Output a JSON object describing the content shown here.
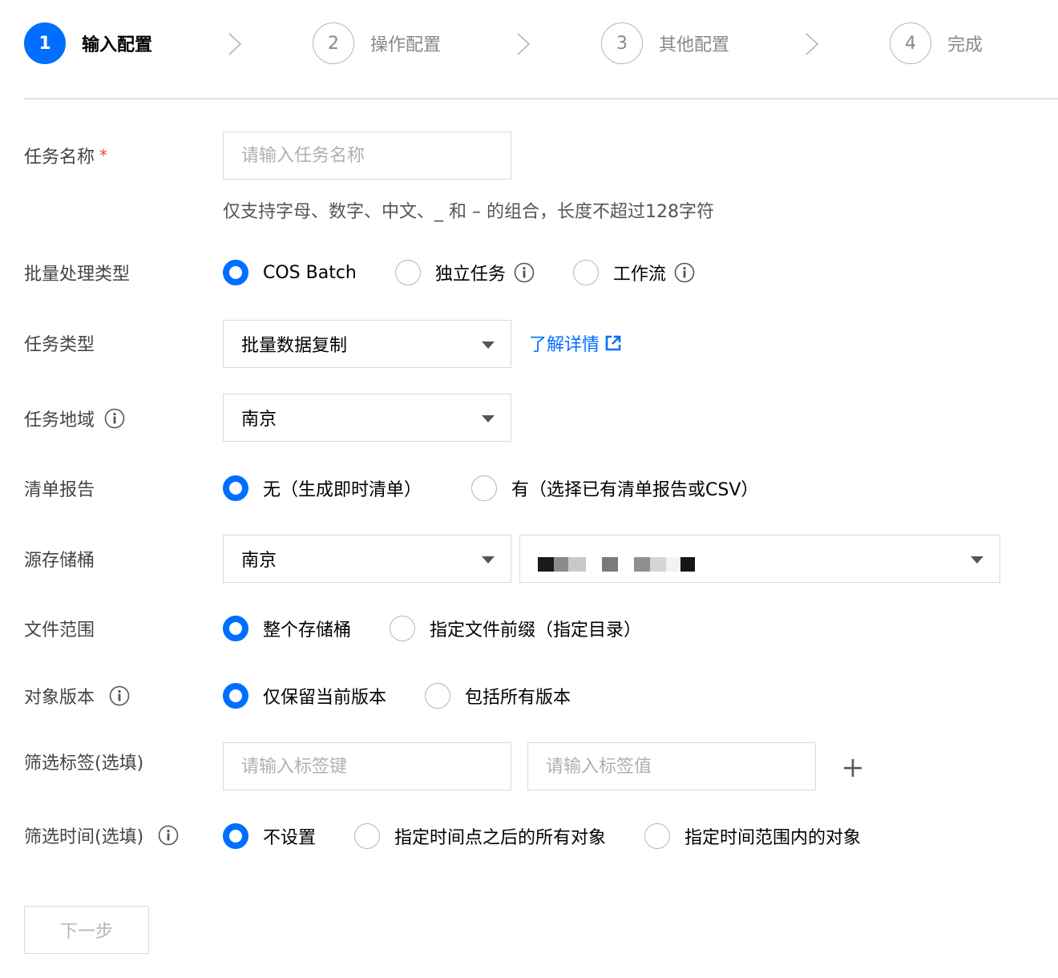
{
  "steps": [
    {
      "number": "1",
      "label": "输入配置",
      "active": true
    },
    {
      "number": "2",
      "label": "操作配置",
      "active": false
    },
    {
      "number": "3",
      "label": "其他配置",
      "active": false
    },
    {
      "number": "4",
      "label": "完成",
      "active": false
    }
  ],
  "form": {
    "task_name": {
      "label": "任务名称",
      "required_mark": "*",
      "placeholder": "请输入任务名称",
      "help": "仅支持字母、数字、中文、_ 和 – 的组合，长度不超过128字符"
    },
    "batch_type": {
      "label": "批量处理类型",
      "options": [
        "COS Batch",
        "独立任务",
        "工作流"
      ],
      "selected": "COS Batch"
    },
    "task_type": {
      "label": "任务类型",
      "value": "批量数据复制",
      "link": "了解详情"
    },
    "task_region": {
      "label": "任务地域",
      "value": "南京"
    },
    "manifest_report": {
      "label": "清单报告",
      "options": [
        "无（生成即时清单）",
        "有（选择已有清单报告或CSV）"
      ],
      "selected": "无（生成即时清单）"
    },
    "source_bucket": {
      "label": "源存储桶",
      "region": "南京",
      "bucket_masked": true
    },
    "file_scope": {
      "label": "文件范围",
      "options": [
        "整个存储桶",
        "指定文件前缀（指定目录）"
      ],
      "selected": "整个存储桶"
    },
    "object_version": {
      "label": "对象版本",
      "options": [
        "仅保留当前版本",
        "包括所有版本"
      ],
      "selected": "仅保留当前版本"
    },
    "filter_tags": {
      "label": "筛选标签(选填)",
      "key_placeholder": "请输入标签键",
      "value_placeholder": "请输入标签值"
    },
    "filter_time": {
      "label": "筛选时间(选填)",
      "options": [
        "不设置",
        "指定时间点之后的所有对象",
        "指定时间范围内的对象"
      ],
      "selected": "不设置"
    }
  },
  "next_button": "下一步",
  "colors": {
    "primary": "#006eff",
    "required": "#e54545",
    "border": "#d9d9d9",
    "muted_text": "#888888"
  }
}
